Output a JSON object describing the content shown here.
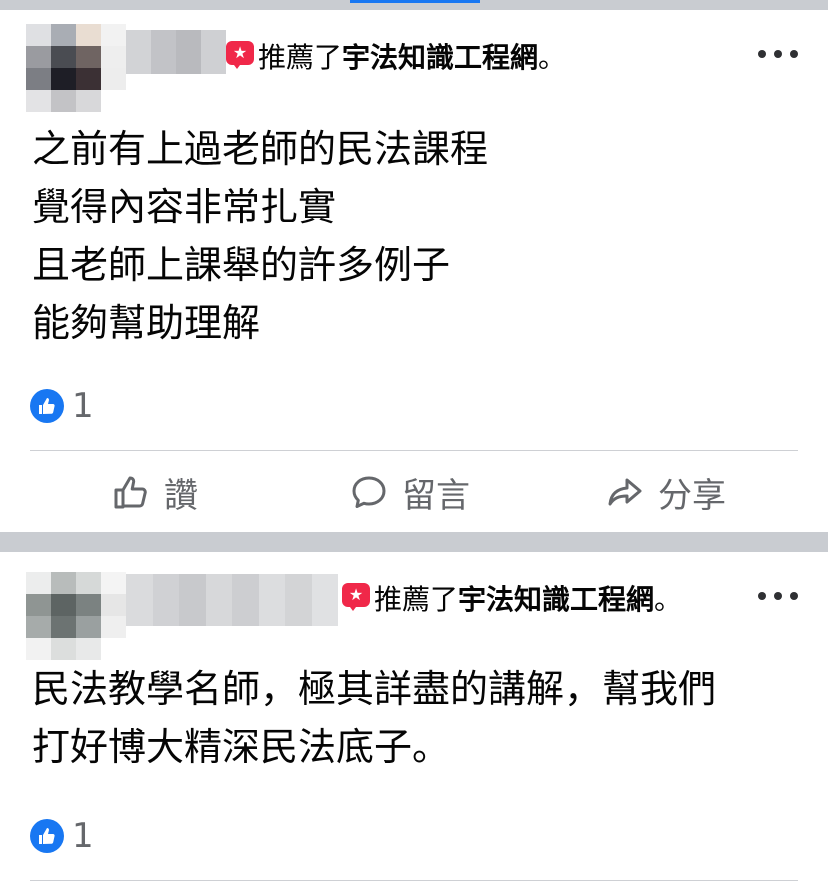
{
  "colors": {
    "feed_background": "#c9ccd1",
    "card_background": "#ffffff",
    "accent_blue": "#1877f2",
    "recommend_red": "#f02849",
    "secondary_text": "#65676b"
  },
  "posts": [
    {
      "recommend": {
        "verb": "推薦了",
        "page_name": "宇法知識工程網",
        "end": "。"
      },
      "body_lines": [
        "之前有上過老師的民法課程",
        "覺得內容非常扎實",
        "且老師上課舉的許多例子",
        "能夠幫助理解"
      ],
      "like_count": "1",
      "actions": {
        "like": "讚",
        "comment": "留言",
        "share": "分享"
      }
    },
    {
      "recommend": {
        "verb": "推薦了",
        "page_name": "宇法知識工程網",
        "end": "。"
      },
      "body_lines": [
        "民法教學名師，極其詳盡的講解，幫我們",
        "打好博大精深民法底子。"
      ],
      "like_count": "1"
    }
  ],
  "icons": {
    "recommend": "recommend-star-icon",
    "more": "more-options-icon",
    "like_reaction": "thumbs-up-icon",
    "like_action": "thumbs-up-outline-icon",
    "comment_action": "comment-bubble-icon",
    "share_action": "share-arrow-icon"
  }
}
